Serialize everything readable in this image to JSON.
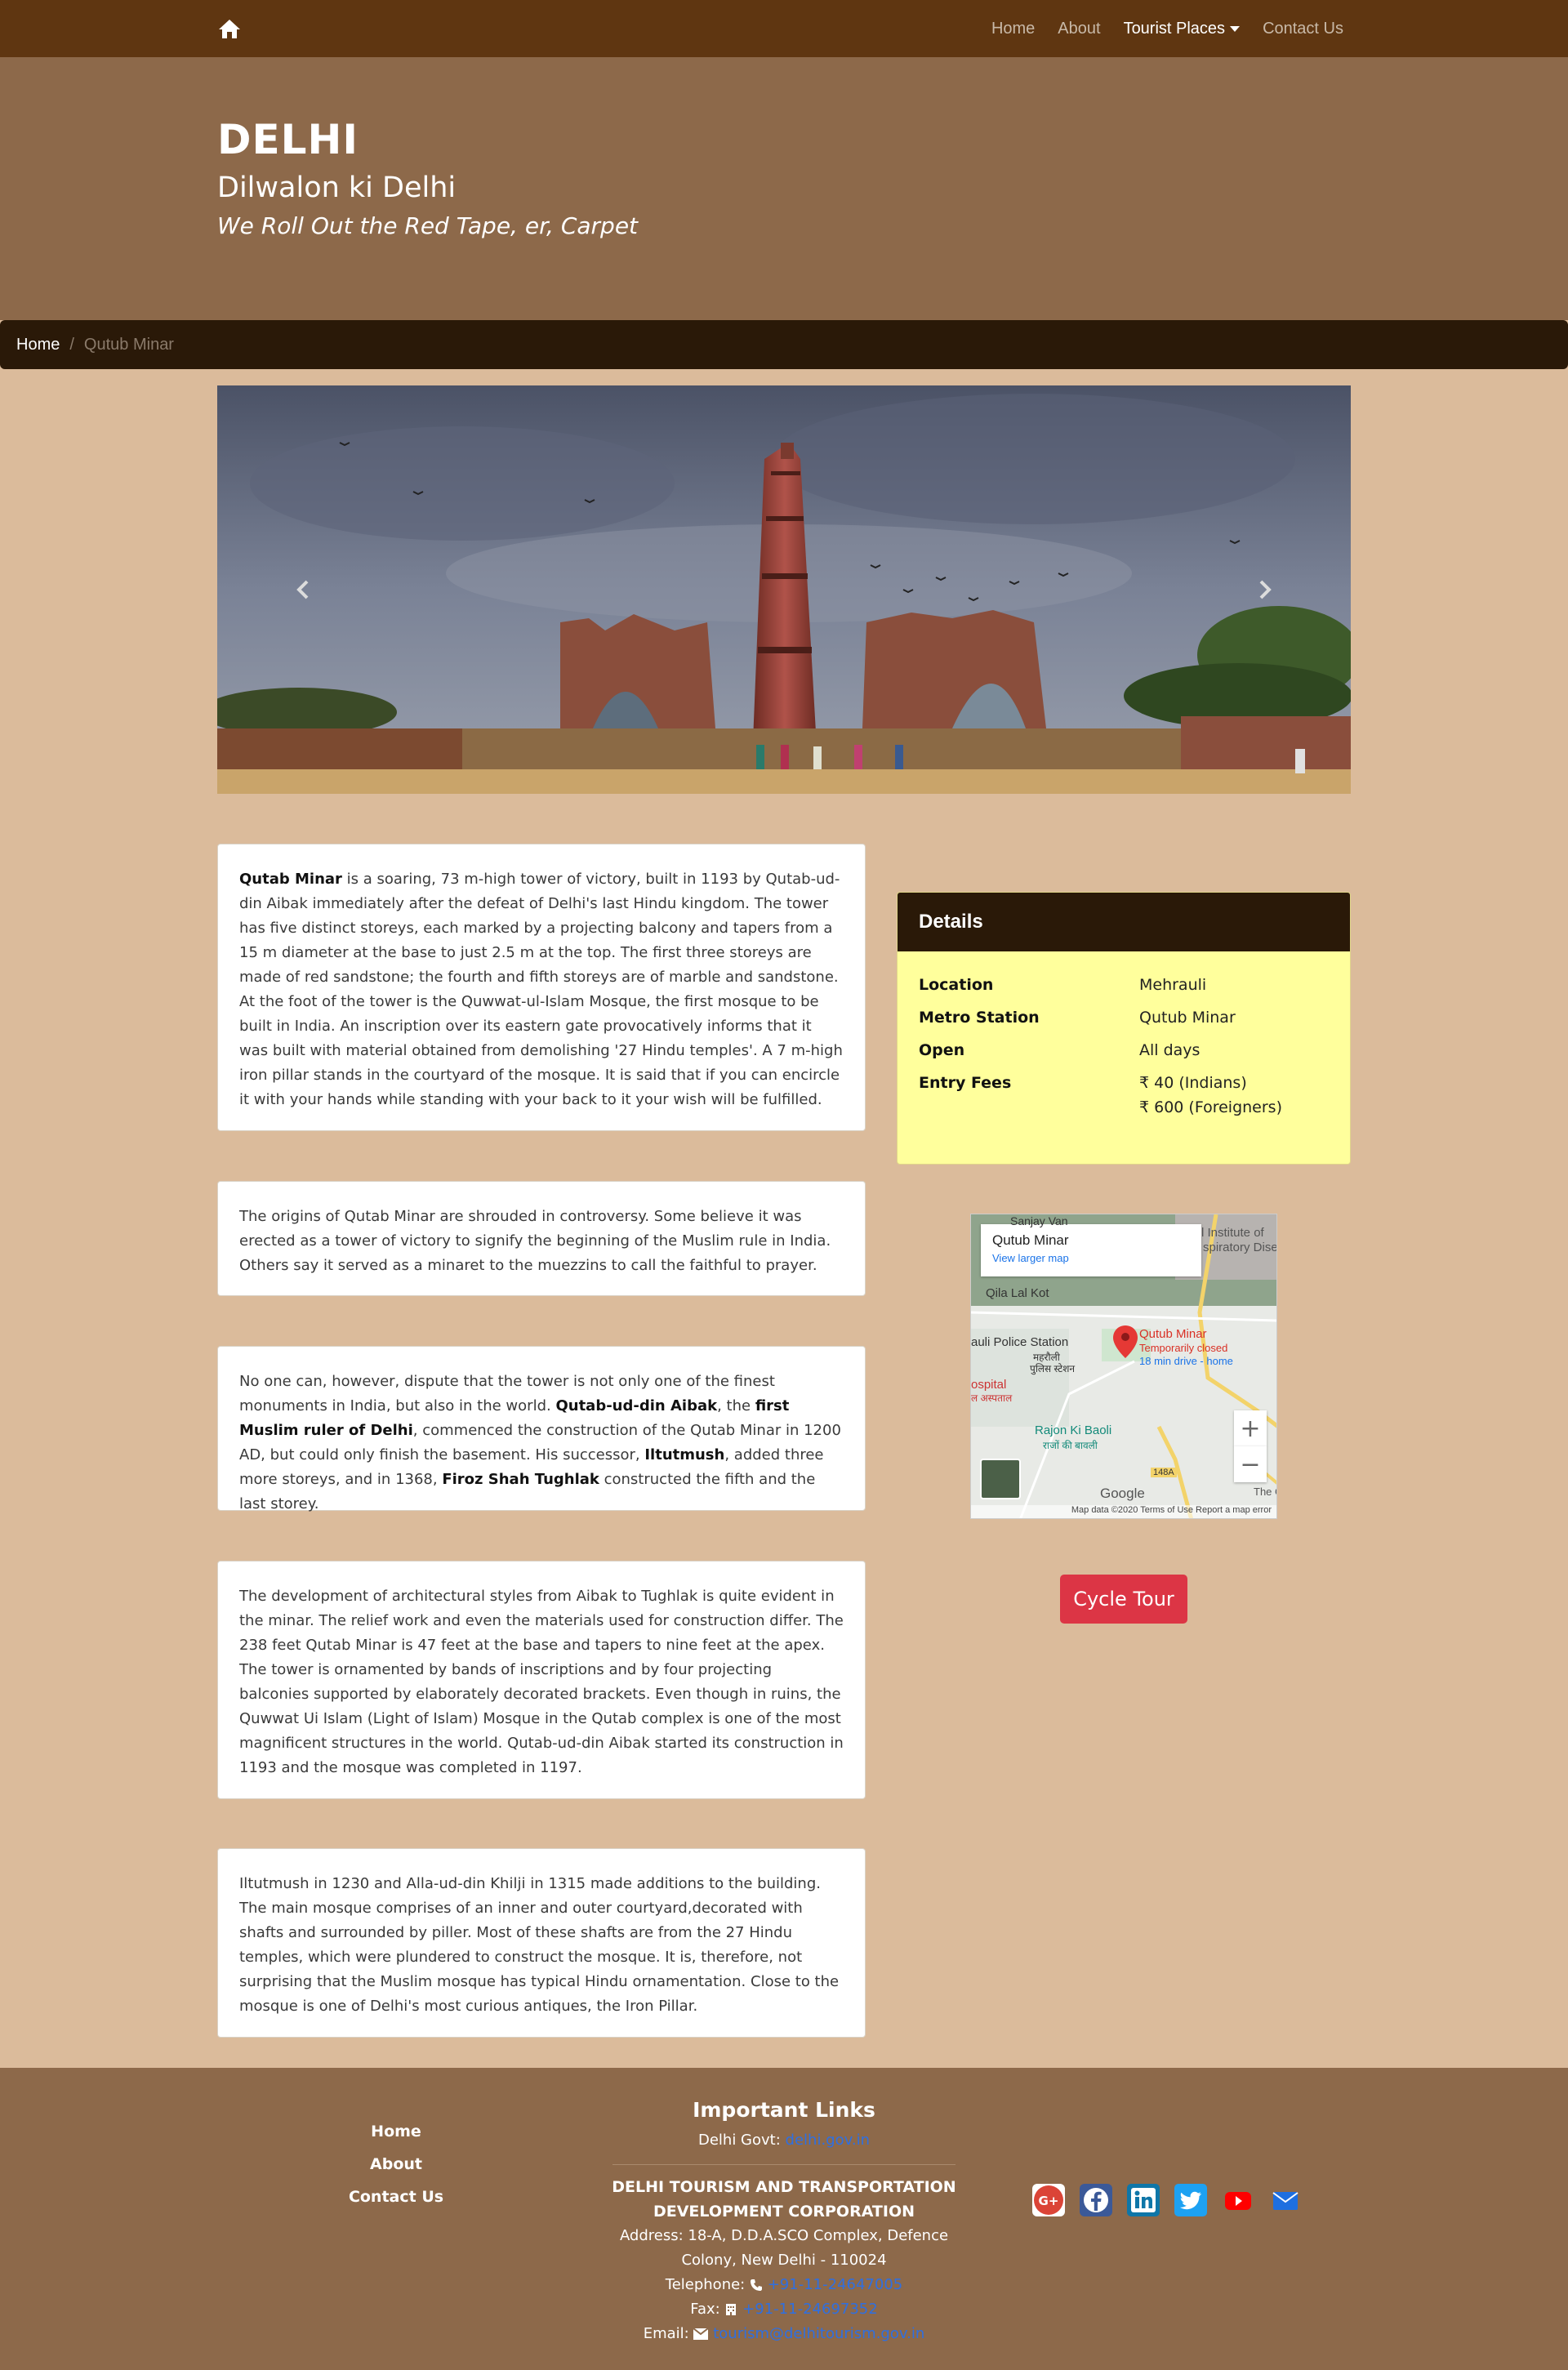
{
  "nav": {
    "home_icon": "home-icon",
    "links": [
      "Home",
      "About",
      "Tourist Places",
      "Contact Us"
    ]
  },
  "hero": {
    "title": "DELHI",
    "subtitle": "Dilwalon ki Delhi",
    "tagline": "We Roll Out the Red Tape, er, Carpet"
  },
  "breadcrumb": {
    "home": "Home",
    "separator": "/",
    "current": "Qutub Minar"
  },
  "carousel": {
    "prev_icon": "chevron-left-icon",
    "next_icon": "chevron-right-icon"
  },
  "cards": [
    {
      "b1": "Qutab Minar",
      "t1": " is a soaring, 73 m-high tower of victory, built in 1193 by Qutab-ud-din Aibak immediately after the defeat of Delhi's last Hindu kingdom. The tower has five distinct storeys, each marked by a projecting balcony and tapers from a 15 m diameter at the base to just 2.5 m at the top. The first three storeys are made of red sandstone; the fourth and fifth storeys are of marble and sandstone. At the foot of the tower is the Quwwat-ul-Islam Mosque, the first mosque to be built in India. An inscription over its eastern gate provocatively informs that it was built with material obtained from demolishing '27 Hindu temples'. A 7 m-high iron pillar stands in the courtyard of the mosque. It is said that if you can encircle it with your hands while standing with your back to it your wish will be fulfilled."
    },
    {
      "t1": "The origins of Qutab Minar are shrouded in controversy. Some believe it was erected as a tower of victory to signify the beginning of the Muslim rule in India. Others say it served as a minaret to the muezzins to call the faithful to prayer."
    },
    {
      "t1": "No one can, however, dispute that the tower is not only one of the finest monuments in India, but also in the world. ",
      "b1": "Qutab-ud-din Aibak",
      "t2": ", the ",
      "b2": "first Muslim ruler of Delhi",
      "t3": ", commenced the construction of the Qutab Minar in 1200 AD, but could only finish the basement. His successor, ",
      "b3": "Iltutmush",
      "t4": ", added three more storeys, and in 1368, ",
      "b4": "Firoz Shah Tughlak",
      "t5": " constructed the fifth and the last storey."
    },
    {
      "t1": "The development of architectural styles from Aibak to Tughlak is quite evident in the minar. The relief work and even the materials used for construction differ. The 238 feet Qutab Minar is 47 feet at the base and tapers to nine feet at the apex. The tower is ornamented by bands of inscriptions and by four projecting balconies supported by elaborately decorated brackets. Even though in ruins, the Quwwat Ui Islam (Light of Islam) Mosque in the Qutab complex is one of the most magnificent structures in the world. Qutab-ud-din Aibak started its construction in 1193 and the mosque was completed in 1197."
    },
    {
      "t1": "Iltutmush in 1230 and Alla-ud-din Khilji in 1315 made additions to the building. The main mosque comprises of an inner and outer courtyard,decorated with shafts and surrounded by piller. Most of these shafts are from the 27 Hindu temples, which were plundered to construct the mosque. It is, therefore, not surprising that the Muslim mosque has typical Hindu ornamentation. Close to the mosque is one of Delhi's most curious antiques, the Iron Pillar."
    }
  ],
  "details": {
    "heading": "Details",
    "rows": [
      {
        "key": "Location",
        "value": "Mehrauli"
      },
      {
        "key": "Metro Station",
        "value": "Qutub Minar"
      },
      {
        "key": "Open",
        "value": "All days"
      },
      {
        "key": "Entry Fees",
        "value": "₹ 40 (Indians)",
        "value2": "₹ 600 (Foreigners)"
      }
    ]
  },
  "map": {
    "place": "Qutub Minar",
    "view_larger": "View larger map",
    "labels": {
      "sanjay": "Sanjay Van",
      "institute": "l Institute of",
      "respiratory": "spiratory Dise",
      "qila": "Qila Lal Kot",
      "police": "auli Police Station",
      "police_hi1": "महरौली",
      "police_hi2": "पुलिस स्टेशन",
      "hospital": "ospital",
      "hospital_hi": "ल अस्पताल",
      "pin_title": "Qutub Minar",
      "pin_status": "Temporarily closed",
      "pin_drive": "18 min drive - home",
      "baoli": "Rajon Ki Baoli",
      "baoli_hi": "राजों की बावली",
      "road": "148A",
      "google": "Google",
      "the_ga": "The Ga"
    },
    "zoom_in": "+",
    "zoom_out": "−",
    "footer": "Map data ©2020   Terms of Use   Report a map error"
  },
  "cycle_button": "Cycle Tour",
  "footer": {
    "links": [
      "Home",
      "About",
      "Contact Us"
    ],
    "important_title": "Important Links",
    "govt_label": "Delhi Govt:",
    "govt_link": "delhi.gov.in",
    "org_name": "DELHI TOURISM AND TRANSPORTATION DEVELOPMENT CORPORATION",
    "address": "Address: 18-A, D.D.A.SCO Complex, Defence Colony, New Delhi - 110024",
    "telephone_label": "Telephone:",
    "telephone": "+91-11-24647005",
    "fax_label": "Fax:",
    "fax": "+91-11-24697352",
    "email_label": "Email:",
    "email": "tourism@delhitourism.gov.in",
    "social_icons": [
      "google-plus-icon",
      "facebook-icon",
      "linkedin-icon",
      "twitter-icon",
      "youtube-icon",
      "email-icon"
    ]
  },
  "colors": {
    "navbar": "#5f3611",
    "hero": "#8d694a",
    "breadcrumb": "#2a1908",
    "page_bg": "#dbbb9b",
    "details_bg": "#ffff9c",
    "cycle_button": "#dc3545"
  }
}
